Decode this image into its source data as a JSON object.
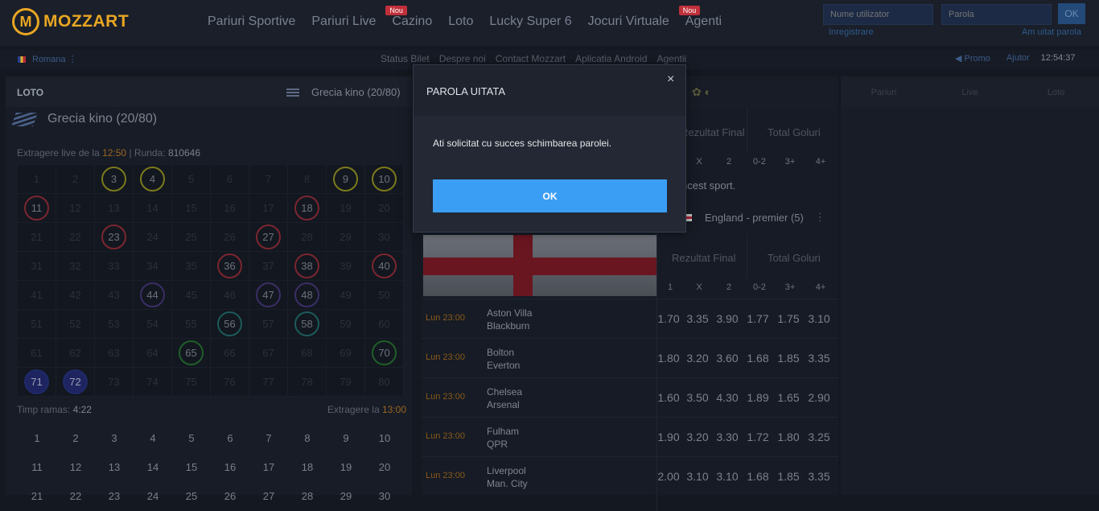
{
  "header": {
    "logo_badge": "M",
    "logo_text": "MOZZART",
    "nav": [
      {
        "label": "Pariuri Sportive"
      },
      {
        "label": "Pariuri Live"
      },
      {
        "label": "Cazino",
        "badge": "Nou"
      },
      {
        "label": "Loto"
      },
      {
        "label": "Lucky Super 6"
      },
      {
        "label": "Jocuri Virtuale"
      },
      {
        "label": "Agenti",
        "badge": "Nou"
      }
    ],
    "login": {
      "username_placeholder": "Nume utilizator",
      "password_placeholder": "Parola",
      "ok_label": "OK",
      "register_label": "Inregistrare",
      "forgot_label": "Am uitat parola"
    }
  },
  "subnav": {
    "language": "Romana",
    "links": [
      "Status Bilet",
      "Despre noi",
      "Contact Mozzart",
      "Aplicatia Android",
      "Agentii"
    ],
    "promo": "Promo",
    "help": "Ajutor",
    "clock": "12:54:37"
  },
  "loto": {
    "title": "LOTO",
    "selected_game": "Grecia kino (20/80)",
    "game_name": "Grecia kino (20/80)",
    "draw_label": "Extragere live de la",
    "draw_time": "12:50",
    "round_label": "| Runda:",
    "round": "810646",
    "time_left_label": "Timp ramas:",
    "time_left": "4:22",
    "next_draw_label": "Extragere la",
    "next_draw_time": "13:00",
    "drawn_numbers": {
      "3": "y",
      "4": "y",
      "9": "y",
      "10": "y",
      "11": "r",
      "18": "r",
      "23": "r",
      "27": "r",
      "36": "r",
      "38": "r",
      "40": "r",
      "44": "p",
      "47": "p",
      "48": "p",
      "56": "t",
      "58": "t",
      "65": "g",
      "70": "g",
      "71": "b",
      "72": "b"
    }
  },
  "sports": {
    "headers": {
      "rezultat": "Rezultat Final",
      "goluri": "Total Goluri",
      "odds": [
        "1",
        "X",
        "2",
        "0-2",
        "3+",
        "4+"
      ]
    },
    "notice": "ncest sport.",
    "league": "England - premier (5)",
    "matches": [
      {
        "time": "Lun 23:00",
        "home": "Aston Villa",
        "away": "Blackburn",
        "odds": [
          "1.70",
          "3.35",
          "3.90",
          "1.77",
          "1.75",
          "3.10"
        ]
      },
      {
        "time": "Lun 23:00",
        "home": "Bolton",
        "away": "Everton",
        "odds": [
          "1.80",
          "3.20",
          "3.60",
          "1.68",
          "1.85",
          "3.35"
        ]
      },
      {
        "time": "Lun 23:00",
        "home": "Chelsea",
        "away": "Arsenal",
        "odds": [
          "1.60",
          "3.50",
          "4.30",
          "1.89",
          "1.65",
          "2.90"
        ]
      },
      {
        "time": "Lun 23:00",
        "home": "Fulham",
        "away": "QPR",
        "odds": [
          "1.90",
          "3.20",
          "3.30",
          "1.72",
          "1.80",
          "3.25"
        ]
      },
      {
        "time": "Lun 23:00",
        "home": "Liverpool",
        "away": "Man. City",
        "odds": [
          "2.00",
          "3.10",
          "3.10",
          "1.68",
          "1.85",
          "3.35"
        ]
      }
    ]
  },
  "right_tabs": [
    "Pariuri",
    "Live",
    "Loto"
  ],
  "modal": {
    "title": "PAROLA UITATA",
    "close": "×",
    "message": "Ati solicitat cu succes schimbarea parolei.",
    "ok_label": "OK"
  }
}
